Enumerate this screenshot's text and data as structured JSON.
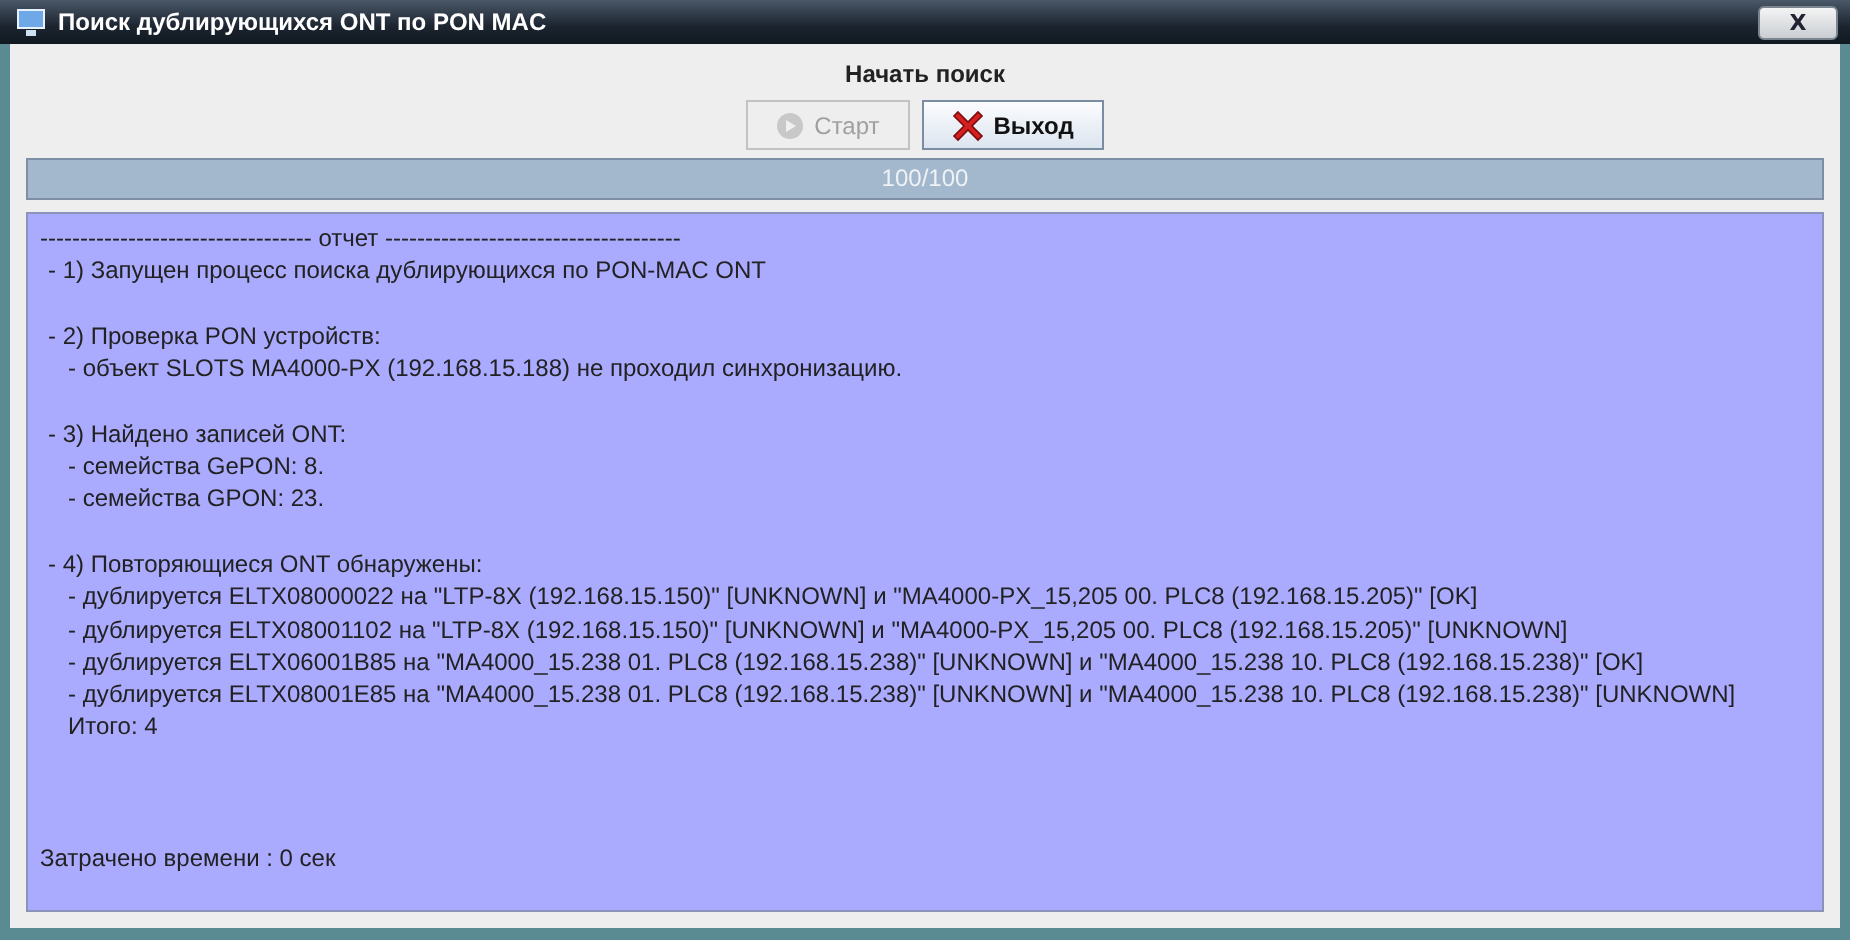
{
  "window": {
    "title": "Поиск дублирующихся ONT по PON MAC",
    "close_label": "X"
  },
  "heading": "Начать поиск",
  "buttons": [
    {
      "kind": "start",
      "label": "Старт",
      "disabled": true
    },
    {
      "kind": "exit",
      "label": "Выход",
      "disabled": false
    }
  ],
  "progress": {
    "level": 1,
    "text": "100/100"
  },
  "report": {
    "title": "---------------------------------- отчет -------------------------------------",
    "sections": [
      {
        "text": "- 1) Запущен процесс поиска дублирующихся по PON-MAC ONT"
      },
      {
        "text": "- 2) Проверка PON устройств:",
        "children": [
          {
            "text": "- объект SLOTS MA4000-PX (192.168.15.188) не проходил синхронизацию."
          }
        ]
      },
      {
        "text": "- 3) Найдено записей ONT:",
        "children": [
          {
            "text": "- семейства GePON: 8."
          },
          {
            "text": "- семейства GPON: 23."
          }
        ]
      },
      {
        "text": "- 4) Повторяющиеся ONT обнаружены:",
        "children": [
          {
            "text": "- дублируется ELTX08000022 на \"LTP-8X (192.168.15.150)\" [UNKNOWN] и \"MA4000-PX_15,205 00. PLC8 (192.168.15.205)\" [OK]"
          },
          {
            "text": "- дублируется ELTX08001102 на \"LTP-8X (192.168.15.150)\" [UNKNOWN] и \"MA4000-PX_15,205 00. PLC8 (192.168.15.205)\" [UNKNOWN]"
          },
          {
            "text": "- дублируется ELTX06001B85 на \"MA4000_15.238 01. PLC8 (192.168.15.238)\" [UNKNOWN] и \"MA4000_15.238 10. PLC8 (192.168.15.238)\" [OK]"
          },
          {
            "text": "- дублируется ELTX08001E85 на \"MA4000_15.238 01. PLC8 (192.168.15.238)\" [UNKNOWN] и \"MA4000_15.238 10. PLC8 (192.168.15.238)\" [UNKNOWN]"
          },
          {
            "text": "Итого: 4"
          }
        ]
      }
    ],
    "footer": "Затрачено времени : 0 сек"
  }
}
